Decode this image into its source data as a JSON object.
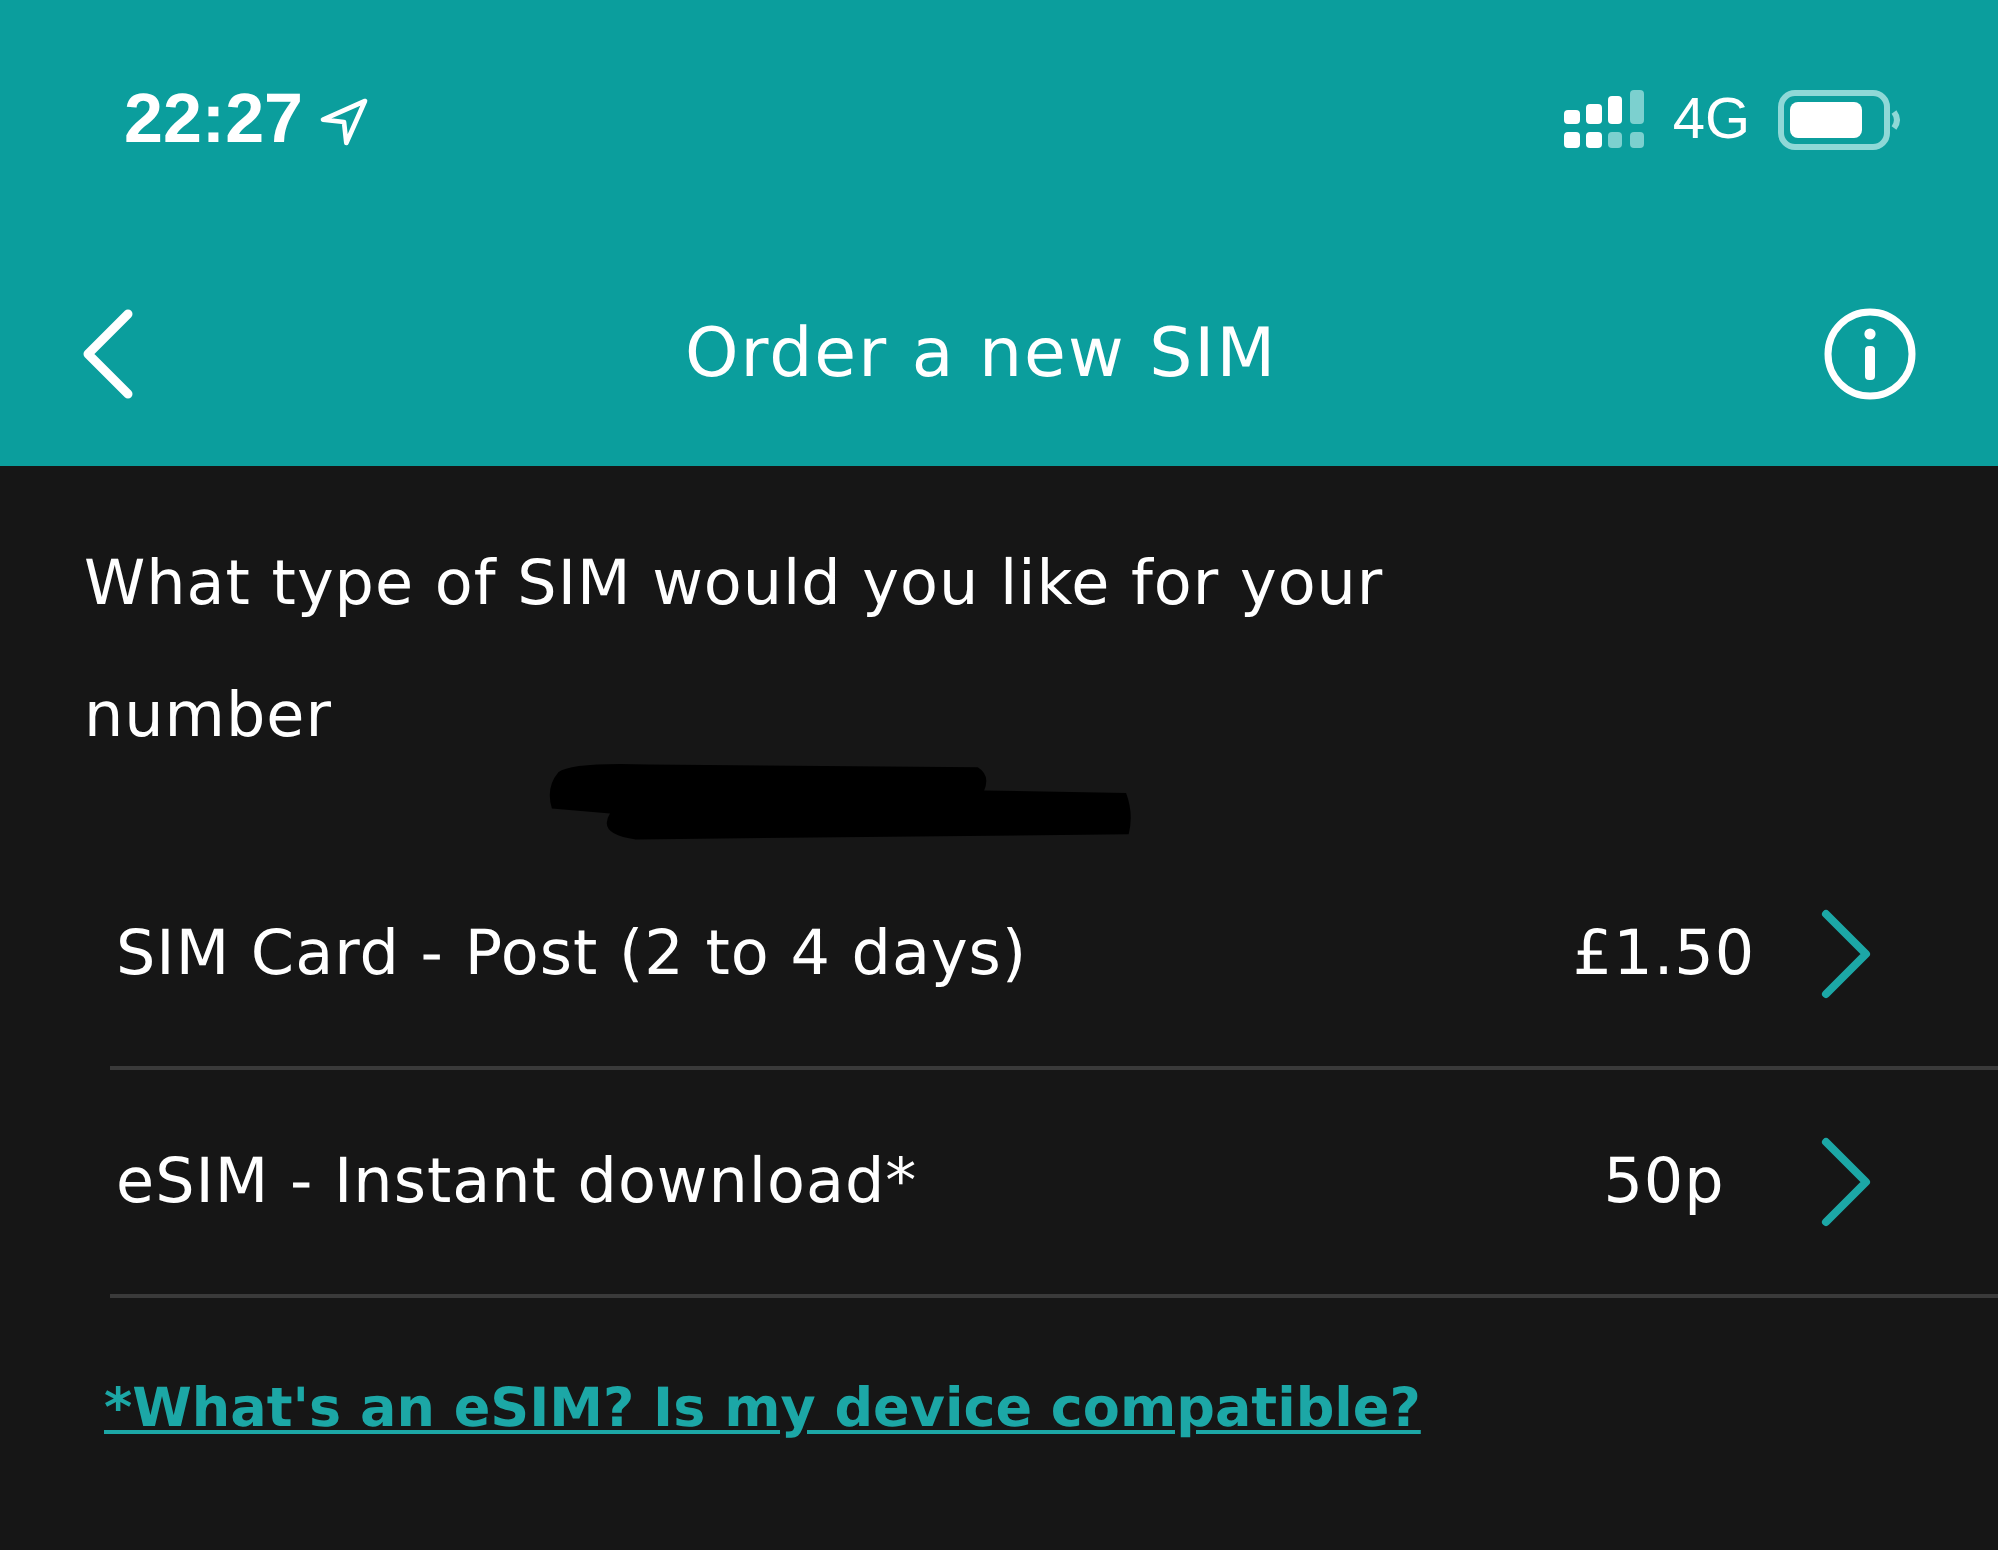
{
  "status_bar": {
    "time": "22:27",
    "network": "4G"
  },
  "header": {
    "title": "Order a new SIM"
  },
  "question": "What type of SIM would you like for your number",
  "options": [
    {
      "label": "SIM Card - Post (2 to 4 days)",
      "price": "£1.50"
    },
    {
      "label": "eSIM - Instant download*",
      "price": "50p"
    }
  ],
  "link": "*What's an eSIM? Is my device compatible?"
}
